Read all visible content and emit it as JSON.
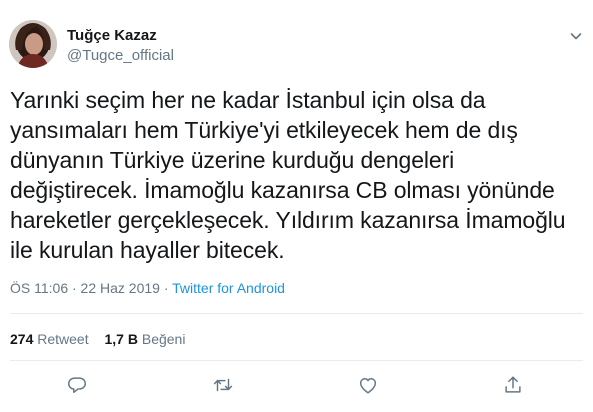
{
  "author": {
    "display_name": "Tuğçe Kazaz",
    "handle": "@Tugce_official"
  },
  "tweet": {
    "lines": [
      "Yarınki seçim her ne kadar İstanbul için olsa da",
      "yansımaları hem Türkiye'yi etkileyecek hem de dış",
      "dünyanın Türkiye üzerine kurduğu dengeleri",
      "değiştirecek. İmamoğlu kazanırsa CB olması yönünde",
      "hareketler gerçekleşecek. Yıldırım kazanırsa İmamoğlu",
      "ile kurulan hayaller bitecek."
    ]
  },
  "meta": {
    "timestamp": "ÖS 11:06 · 22 Haz 2019 · ",
    "source": "Twitter for Android"
  },
  "stats": {
    "retweets_count": "274",
    "retweets_label": "Retweet",
    "likes_count": "1,7 B",
    "likes_label": "Beğeni"
  },
  "icons": {
    "caret": "chevron-down-icon",
    "reply": "reply-icon",
    "retweet": "retweet-icon",
    "like": "heart-icon",
    "share": "share-icon"
  },
  "colors": {
    "text": "#14171a",
    "secondary": "#657786",
    "link": "#1b95e0",
    "divider": "#e6ecf0"
  }
}
